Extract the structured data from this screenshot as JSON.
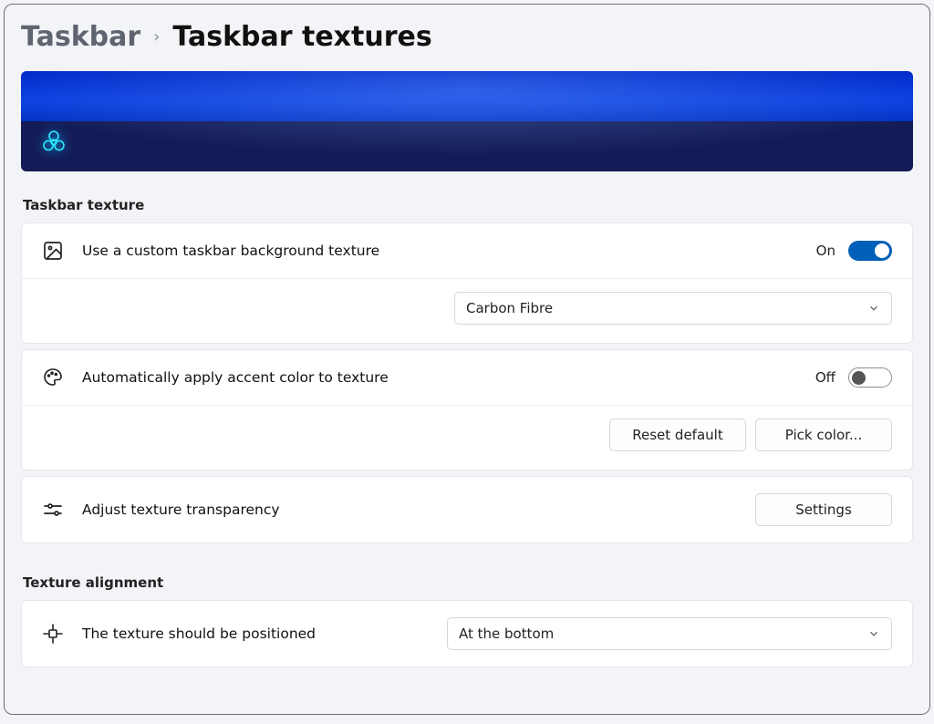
{
  "breadcrumb": {
    "parent": "Taskbar",
    "current": "Taskbar textures"
  },
  "sections": {
    "texture_label": "Taskbar texture",
    "alignment_label": "Texture alignment"
  },
  "custom_texture": {
    "title": "Use a custom taskbar background texture",
    "state_label": "On",
    "dropdown_value": "Carbon Fibre"
  },
  "accent": {
    "title": "Automatically apply accent color to texture",
    "state_label": "Off",
    "reset_label": "Reset default",
    "pick_label": "Pick color..."
  },
  "transparency": {
    "title": "Adjust texture transparency",
    "settings_label": "Settings"
  },
  "alignment": {
    "title": "The texture should be positioned",
    "dropdown_value": "At the bottom"
  }
}
